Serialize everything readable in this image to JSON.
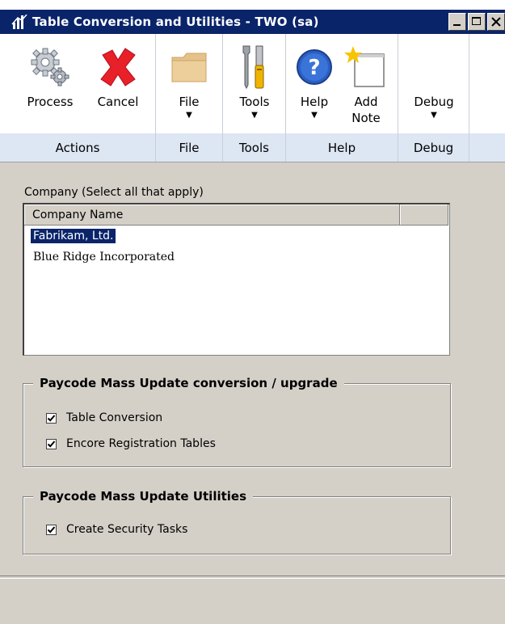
{
  "window": {
    "title": "Table Conversion and Utilities  -  TWO (sa)"
  },
  "ribbon": {
    "groups": [
      {
        "label": "Actions",
        "buttons": [
          {
            "label": "Process",
            "icon": "gears-icon"
          },
          {
            "label": "Cancel",
            "icon": "red-x-icon"
          }
        ]
      },
      {
        "label": "File",
        "buttons": [
          {
            "label": "File",
            "icon": "folder-icon"
          }
        ]
      },
      {
        "label": "Tools",
        "buttons": [
          {
            "label": "Tools",
            "icon": "tools-icon"
          }
        ]
      },
      {
        "label": "Help",
        "buttons": [
          {
            "label": "Help",
            "icon": "help-icon"
          },
          {
            "label": "Add",
            "label2": "Note",
            "icon": "note-icon"
          }
        ]
      },
      {
        "label": "Debug",
        "buttons": [
          {
            "label": "Debug",
            "icon": "debug-icon"
          }
        ]
      }
    ],
    "dropdown_arrow": "▼"
  },
  "company": {
    "label": "Company (Select all that apply)",
    "column_header": "Company Name",
    "rows": [
      {
        "name": "Fabrikam, Ltd.",
        "selected": true
      },
      {
        "name": "Blue Ridge Incorporated",
        "selected": false
      }
    ]
  },
  "conversion_group": {
    "title": "Paycode Mass Update conversion / upgrade",
    "items": [
      {
        "label": "Table Conversion",
        "checked": true
      },
      {
        "label": "Encore Registration Tables",
        "checked": true
      }
    ]
  },
  "utilities_group": {
    "title": "Paycode Mass Update Utilities",
    "items": [
      {
        "label": "Create Security Tasks",
        "checked": true
      }
    ]
  },
  "colors": {
    "titlebar": "#0a246a",
    "selection": "#0a246a",
    "dialog": "#d4d0c8",
    "ribbon_band": "#dde6f3"
  }
}
